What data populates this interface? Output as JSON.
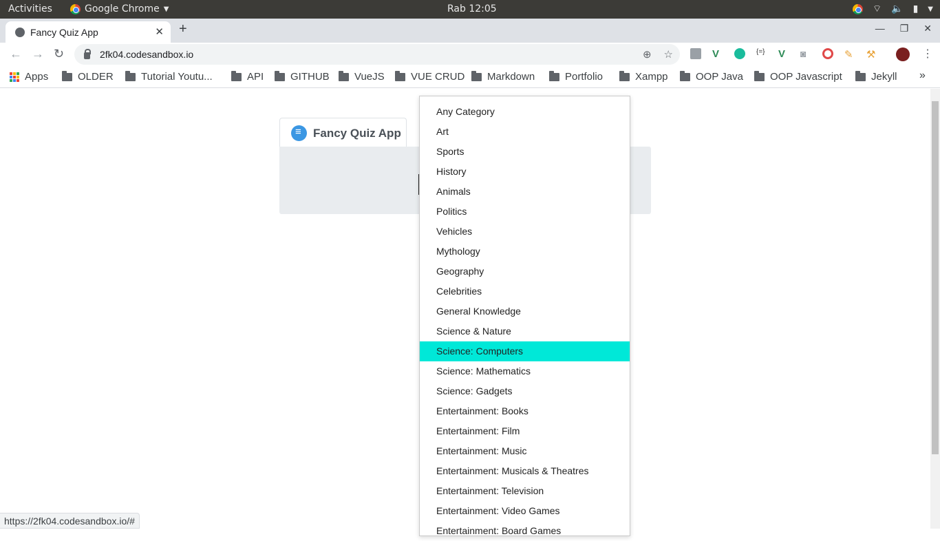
{
  "system_bar": {
    "activities": "Activities",
    "app_name": "Google Chrome",
    "clock": "Rab 12:05"
  },
  "browser": {
    "tab_title": "Fancy Quiz App",
    "url": "2fk04.codesandbox.io",
    "status_url": "https://2fk04.codesandbox.io/#"
  },
  "bookmarks": [
    "Apps",
    "OLDER",
    "Tutorial Youtu...",
    "API",
    "GITHUB",
    "VueJS",
    "VUE CRUD",
    "Markdown",
    "Portfolio",
    "Xampp",
    "OOP Java",
    "OOP Javascript",
    "Jekyll"
  ],
  "quiz": {
    "tab_label": "Fancy Quiz App"
  },
  "dropdown": {
    "options": [
      "Any Category",
      "Art",
      "Sports",
      "History",
      "Animals",
      "Politics",
      "Vehicles",
      "Mythology",
      "Geography",
      "Celebrities",
      "General Knowledge",
      "Science & Nature",
      "Science: Computers",
      "Science: Mathematics",
      "Science: Gadgets",
      "Entertainment: Books",
      "Entertainment: Film",
      "Entertainment: Music",
      "Entertainment: Musicals & Theatres",
      "Entertainment: Television",
      "Entertainment: Video Games",
      "Entertainment: Board Games"
    ],
    "highlighted": "Science: Computers",
    "highlight_color": "#00e8d8"
  },
  "icons": {
    "back": "arrow-left-icon",
    "forward": "arrow-right-icon",
    "reload": "reload-icon",
    "star": "bookmark-star-icon",
    "menu": "kebab-menu-icon"
  }
}
